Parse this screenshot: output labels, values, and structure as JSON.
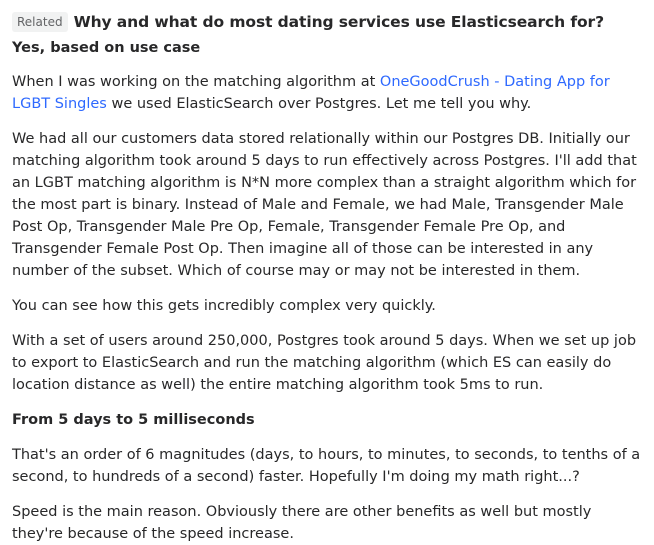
{
  "header": {
    "related_tag": "Related",
    "question_title": "Why and what do most dating services use Elasticsearch for?"
  },
  "answer": {
    "subheading_1": "Yes, based on use case",
    "p1_before": "When I was working on the matching algorithm at ",
    "p1_link": "OneGoodCrush - Dating App for LGBT Singles",
    "p1_after": " we used ElasticSearch over Postgres. Let me tell you why.",
    "p2": "We had all our customers data stored relationally within our Postgres DB. Initially our matching algorithm took around 5 days to run effectively across Postgres. I'll add that an LGBT matching algorithm is N*N more complex than a straight algorithm which for the most part is binary. Instead of Male and Female, we had Male, Transgender Male Post Op, Transgender Male Pre Op, Female, Transgender Female Pre Op, and Transgender Female Post Op. Then imagine all of those can be interested in any number of the subset. Which of course may or may not be interested in them.",
    "p3": "You can see how this gets incredibly complex very quickly.",
    "p4": "With a set of users around 250,000, Postgres took around 5 days. When we set up job to export to ElasticSearch and run the matching algorithm (which ES can easily do location distance as well) the entire matching algorithm took 5ms to run.",
    "subheading_2": "From 5 days to 5 milliseconds",
    "p5": "That's an order of 6 magnitudes (days, to hours, to minutes, to seconds, to tenths of a second, to hundreds of a second) faster. Hopefully I'm doing my math right...?",
    "p6": "Speed is the main reason. Obviously there are other benefits as well but mostly they're because of the speed increase."
  }
}
